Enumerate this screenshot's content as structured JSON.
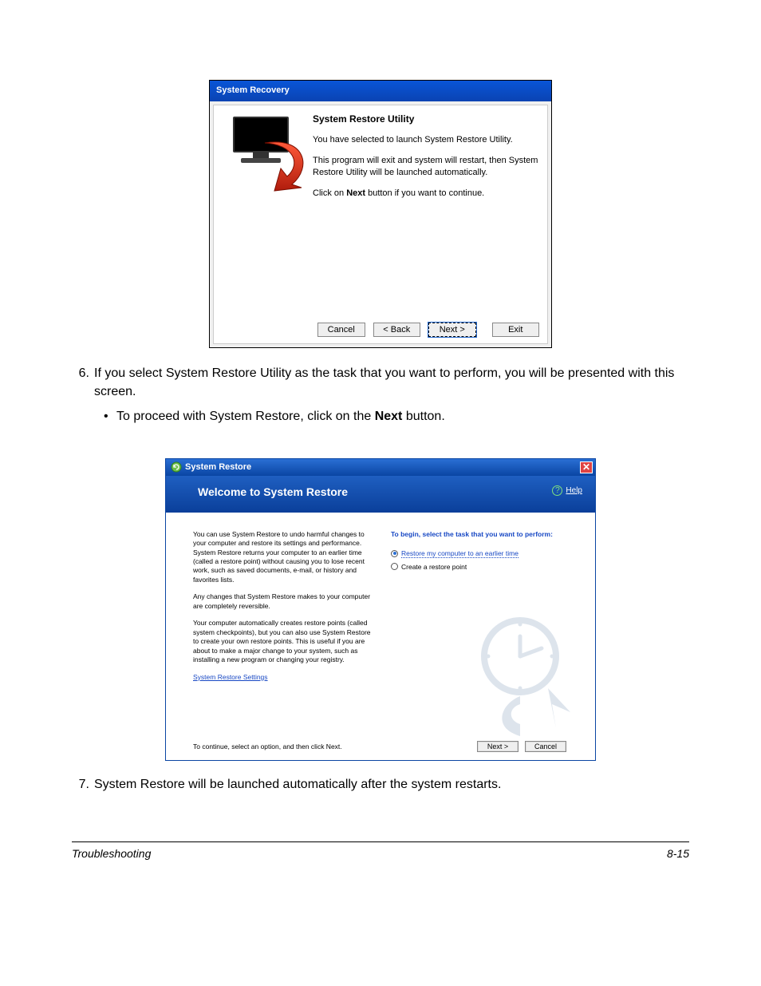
{
  "screenshot1": {
    "window_title": "System Recovery",
    "heading": "System Restore Utility",
    "p1": "You have selected to launch System Restore Utility.",
    "p2": "This program will exit and system will restart, then System Restore Utility will be launched automatically.",
    "p3_pre": "Click on ",
    "p3_bold": "Next",
    "p3_post": " button if you want to continue.",
    "btn_cancel": "Cancel",
    "btn_back": "< Back",
    "btn_next": "Next >",
    "btn_exit": "Exit"
  },
  "step6": {
    "num": "6.",
    "text": "If you select System Restore Utility as the task that you want to perform, you will be presented with this screen."
  },
  "step6_bullet_pre": "To proceed with System Restore, click on the ",
  "step6_bullet_bold": "Next",
  "step6_bullet_post": " button.",
  "screenshot2": {
    "window_title": "System Restore",
    "header_title": "Welcome to System Restore",
    "help_label": "Help",
    "left_p1": "You can use System Restore to undo harmful changes to your computer and restore its settings and performance. System Restore returns your computer to an earlier time (called a restore point) without causing you to lose recent work, such as saved documents, e-mail, or history and favorites lists.",
    "left_p2": "Any changes that System Restore makes to your computer are completely reversible.",
    "left_p3": "Your computer automatically creates restore points (called system checkpoints), but you can also use System Restore to create your own restore points. This is useful if you are about to make a major change to your system, such as installing a new program or changing your registry.",
    "left_link": "System Restore Settings",
    "right_prompt": "To begin, select the task that you want to perform:",
    "radio1": "Restore my computer to an earlier time",
    "radio2": "Create a restore point",
    "footer_hint": "To continue, select an option, and then click Next.",
    "btn_next": "Next >",
    "btn_cancel": "Cancel"
  },
  "step7": {
    "num": "7.",
    "text": "System Restore will be launched automatically after the system restarts."
  },
  "footer": {
    "section": "Troubleshooting",
    "pagenum": "8-15"
  }
}
